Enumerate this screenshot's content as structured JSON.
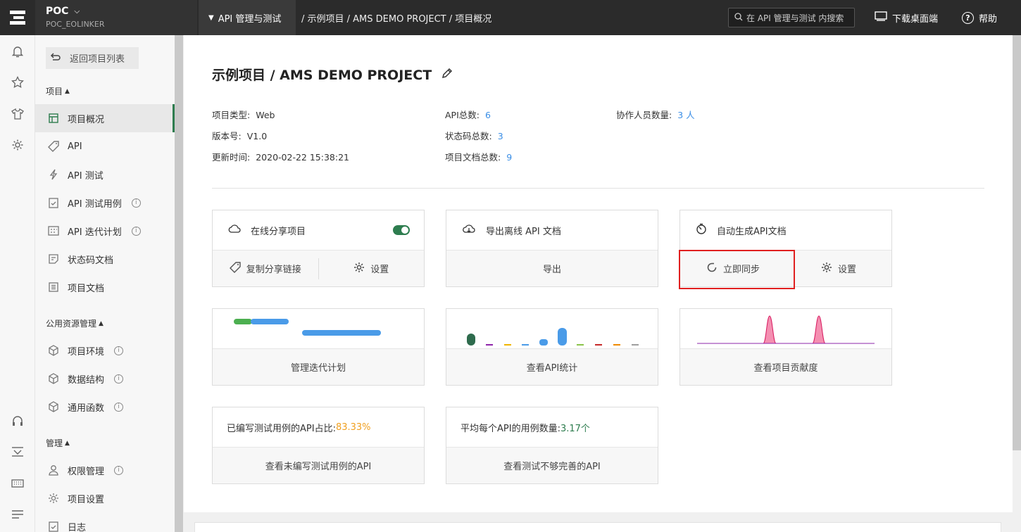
{
  "topbar": {
    "project_name": "POC",
    "project_sub": "POC_EOLINKER",
    "module": "API 管理与测试",
    "breadcrumb": "/ 示例项目 / AMS DEMO PROJECT  / 项目概况",
    "search_placeholder": "在 API 管理与测试 内搜索",
    "download": "下载桌面端",
    "help": "帮助"
  },
  "sidebar": {
    "back": "返回项目列表",
    "sec_project": "项目",
    "items_project": [
      "项目概况",
      "API",
      "API 测试",
      "API 测试用例",
      "API 迭代计划",
      "状态码文档",
      "项目文档"
    ],
    "sec_public": "公用资源管理",
    "items_public": [
      "项目环境",
      "数据结构",
      "通用函数"
    ],
    "sec_manage": "管理",
    "items_manage": [
      "权限管理",
      "项目设置",
      "日志"
    ]
  },
  "overview": {
    "title": "示例项目 / AMS DEMO PROJECT",
    "type_label": "项目类型:",
    "type_value": "Web",
    "version_label": "版本号:",
    "version_value": "V1.0",
    "updated_label": "更新时间:",
    "updated_value": "2020-02-22 15:38:21",
    "api_total_label": "API总数:",
    "api_total_value": "6",
    "status_total_label": "状态码总数:",
    "status_total_value": "3",
    "docs_total_label": "项目文档总数:",
    "docs_total_value": "9",
    "members_label": "协作人员数量:",
    "members_value": "3 人"
  },
  "cards": {
    "share_title": "在线分享项目",
    "copy_link": "复制分享链接",
    "settings": "设置",
    "export_title": "导出离线 API 文档",
    "export": "导出",
    "autogen_title": "自动生成API文档",
    "sync_now": "立即同步",
    "iteration": "管理迭代计划",
    "api_stats": "查看API统计",
    "contribution": "查看项目贡献度",
    "coverage_label": "已编写测试用例的API占比:",
    "coverage_value": "83.33%",
    "avg_label": "平均每个API的用例数量:",
    "avg_value": "3.17个",
    "untested": "查看未编写测试用例的API",
    "incomplete": "查看测试不够完善的API"
  },
  "colors": {
    "accent": "#2e7d4f",
    "link": "#3a8ee6",
    "warn": "#f0a020",
    "highlight": "#e02020"
  }
}
